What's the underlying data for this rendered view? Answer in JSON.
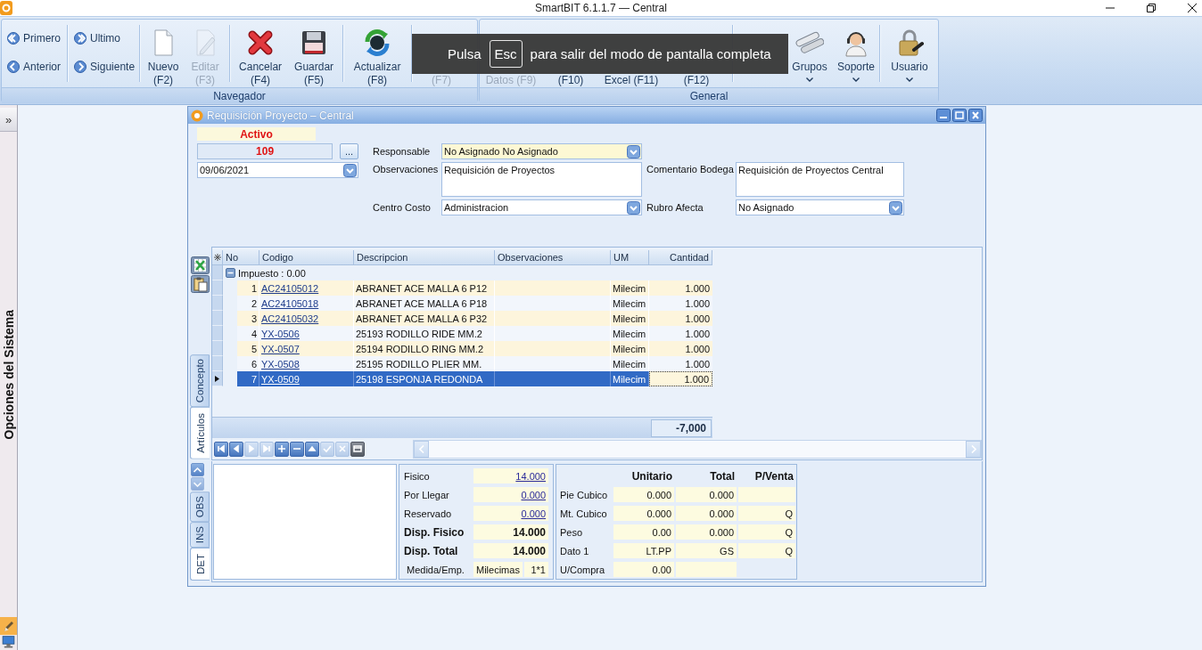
{
  "window": {
    "title": "SmartBIT 6.1.1.7 — Central"
  },
  "ribbon": {
    "groups": [
      {
        "label": "Navegador",
        "nav_columns": [
          [
            {
              "label": "Primero"
            },
            {
              "label": "Anterior"
            }
          ],
          [
            {
              "label": "Ultimo"
            },
            {
              "label": "Siguiente"
            }
          ]
        ],
        "buttons": [
          {
            "lines": [
              "Nuevo",
              "(F2)"
            ],
            "disabled": false,
            "dropdown": false,
            "covered": false
          },
          {
            "lines": [
              "Editar",
              "(F3)"
            ],
            "disabled": true,
            "dropdown": false,
            "covered": false
          },
          {
            "lines": [
              "Cancelar",
              "(F4)"
            ],
            "disabled": false,
            "dropdown": false,
            "covered": false
          },
          {
            "lines": [
              "Guardar",
              "(F5)"
            ],
            "disabled": false,
            "dropdown": false,
            "covered": false
          },
          {
            "lines": [
              "Actualizar",
              "(F8)"
            ],
            "disabled": false,
            "dropdown": false,
            "covered": false
          },
          {
            "lines": [
              "(F7)"
            ],
            "disabled": true,
            "dropdown": false,
            "covered": true
          }
        ]
      },
      {
        "label": "General",
        "buttons": [
          {
            "lines": [
              "Datos (F9)"
            ],
            "disabled": true,
            "dropdown": false,
            "covered": true
          },
          {
            "lines": [
              "(F10)"
            ],
            "disabled": false,
            "dropdown": false,
            "covered": true
          },
          {
            "lines": [
              "Excel (F11)"
            ],
            "disabled": false,
            "dropdown": false,
            "covered": true
          },
          {
            "lines": [
              "(F12)"
            ],
            "disabled": false,
            "dropdown": false,
            "covered": true
          },
          {
            "lines": [
              "Grupos"
            ],
            "disabled": false,
            "dropdown": true,
            "covered": false
          },
          {
            "lines": [
              "Soporte"
            ],
            "disabled": false,
            "dropdown": true,
            "covered": false
          },
          {
            "lines": [
              "Usuario"
            ],
            "disabled": false,
            "dropdown": true,
            "covered": false
          }
        ]
      }
    ]
  },
  "fullscreen_notice": {
    "before": "Pulsa",
    "key": "Esc",
    "after": "para salir del modo de pantalla completa"
  },
  "sidebar": {
    "toggle": "»",
    "title": "Opciones del Sistema"
  },
  "form": {
    "title": "Requisición Proyecto – Central",
    "status": "Activo",
    "number": "109",
    "lookup": "...",
    "date": "09/06/2021",
    "rows": [
      [
        {
          "label": "Responsable",
          "value": "No Asignado No Asignado",
          "kind": "combo",
          "required": true
        }
      ],
      [
        {
          "label": "Observaciones",
          "value": "Requisición de Proyectos",
          "kind": "memo",
          "required": false
        },
        {
          "label": "Comentario Bodega",
          "value": "Requisición de Proyectos Central",
          "kind": "memo",
          "required": false
        }
      ],
      [
        {
          "label": "Centro Costo",
          "value": "Administracion",
          "kind": "combo",
          "required": false
        },
        {
          "label": "Rubro Afecta",
          "value": "No Asignado",
          "kind": "combo",
          "required": false
        }
      ]
    ]
  },
  "grid": {
    "tabs": [
      {
        "label": "Concepto",
        "selected": false
      },
      {
        "label": "Artículos",
        "selected": true
      }
    ],
    "columns": [
      "No",
      "Codigo",
      "Descripcion",
      "Observaciones",
      "UM",
      "Cantidad"
    ],
    "group": {
      "label": "Impuesto : 0.00",
      "expanded": true
    },
    "rows": [
      {
        "no": "1",
        "code": "AC24105012",
        "description": "ABRANET ACE MALLA 6 P12",
        "unit": "Milecim",
        "quantity": "1.000",
        "selected": false
      },
      {
        "no": "2",
        "code": "AC24105018",
        "description": "ABRANET ACE MALLA 6 P18",
        "unit": "Milecim",
        "quantity": "1.000",
        "selected": false
      },
      {
        "no": "3",
        "code": "AC24105032",
        "description": "ABRANET ACE MALLA 6 P32",
        "unit": "Milecim",
        "quantity": "1.000",
        "selected": false
      },
      {
        "no": "4",
        "code": "YX-0506",
        "description": "25193 RODILLO RIDE MM.2",
        "unit": "Milecim",
        "quantity": "1.000",
        "selected": false
      },
      {
        "no": "5",
        "code": "YX-0507",
        "description": "25194 RODILLO RING MM.2",
        "unit": "Milecim",
        "quantity": "1.000",
        "selected": false
      },
      {
        "no": "6",
        "code": "YX-0508",
        "description": "25195 RODILLO PLIER MM.",
        "unit": "Milecim",
        "quantity": "1.000",
        "selected": false
      },
      {
        "no": "7",
        "code": "YX-0509",
        "description": "25198 ESPONJA REDONDA",
        "unit": "Milecim",
        "quantity": "1.000",
        "selected": true
      }
    ],
    "total": "-7,000",
    "navigator": [
      {
        "disabled": false
      },
      {
        "disabled": false
      },
      {
        "disabled": true
      },
      {
        "disabled": true
      },
      {
        "disabled": false
      },
      {
        "disabled": false
      },
      {
        "disabled": false
      },
      {
        "disabled": true
      },
      {
        "disabled": true
      },
      {
        "disabled": false
      }
    ]
  },
  "detail": {
    "tabs": [
      {
        "label": "OBS",
        "selected": false
      },
      {
        "label": "INS",
        "selected": false
      },
      {
        "label": "DET",
        "selected": true
      }
    ],
    "stock": [
      {
        "label": "Fisico",
        "kind": "link",
        "values": [
          "14.000"
        ]
      },
      {
        "label": "Por Llegar",
        "kind": "link",
        "values": [
          "0.000"
        ]
      },
      {
        "label": "Reservado",
        "kind": "link",
        "values": [
          "0.000"
        ]
      },
      {
        "label": "Disp. Fisico",
        "kind": "bold",
        "values": [
          "14.000"
        ]
      },
      {
        "label": "Disp. Total",
        "kind": "bold",
        "values": [
          "14.000"
        ]
      },
      {
        "label": "Medida/Emp.",
        "kind": "plain",
        "values": [
          "Milecimas",
          "1*1"
        ]
      }
    ],
    "measures": {
      "columns": [
        "Unitario",
        "Total",
        "P/Venta"
      ],
      "rows": [
        {
          "label": "Pie Cubico",
          "cells": [
            {
              "kind": "value",
              "text": "0.000"
            },
            {
              "kind": "value",
              "text": "0.000"
            },
            {
              "kind": "blank"
            }
          ]
        },
        {
          "label": "Mt. Cubico",
          "cells": [
            {
              "kind": "value",
              "text": "0.000"
            },
            {
              "kind": "value",
              "text": "0.000"
            },
            {
              "kind": "value",
              "text": "Q"
            }
          ]
        },
        {
          "label": "Peso",
          "cells": [
            {
              "kind": "value",
              "text": "0.00"
            },
            {
              "kind": "value",
              "text": "0.000"
            },
            {
              "kind": "value",
              "text": "Q"
            }
          ]
        },
        {
          "label": "Dato 1",
          "cells": [
            {
              "kind": "value",
              "text": "LT.PP"
            },
            {
              "kind": "value",
              "text": "GS"
            },
            {
              "kind": "value",
              "text": "Q"
            }
          ]
        },
        {
          "label": "U/Compra",
          "cells": [
            {
              "kind": "value",
              "text": "0.00"
            },
            {
              "kind": "blank"
            }
          ]
        }
      ]
    }
  }
}
